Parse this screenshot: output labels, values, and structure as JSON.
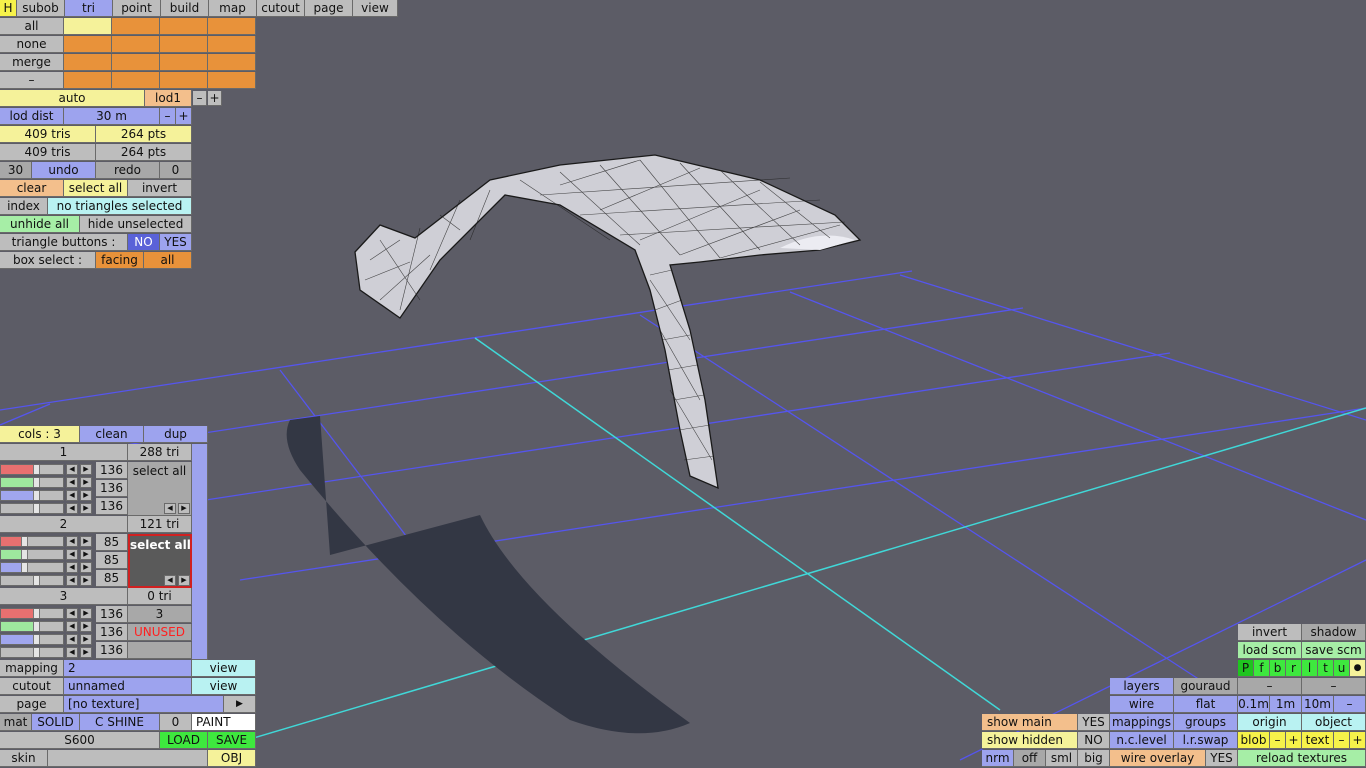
{
  "tabs": [
    "subob",
    "tri",
    "point",
    "build",
    "map",
    "cutout",
    "page",
    "view"
  ],
  "h_label": "H",
  "side_buttons": [
    "all",
    "none",
    "merge",
    "–"
  ],
  "lod": {
    "auto": "auto",
    "name": "lod1",
    "minus": "–",
    "plus": "+",
    "dist_label": "lod dist",
    "dist_value": "30 m"
  },
  "counts": {
    "tris1": "409 tris",
    "pts1": "264 pts",
    "tris2": "409 tris",
    "pts2": "264 pts"
  },
  "undo": {
    "count": "30",
    "undo": "undo",
    "redo": "redo",
    "redo_count": "0"
  },
  "select": {
    "clear": "clear",
    "select_all": "select all",
    "invert": "invert",
    "index": "index",
    "status": "no triangles selected",
    "unhide_all": "unhide all",
    "hide_unselected": "hide unselected",
    "tri_buttons_label": "triangle buttons :",
    "no": "NO",
    "yes": "YES",
    "box_select_label": "box select :",
    "facing": "facing",
    "all": "all"
  },
  "cols": {
    "label": "cols : 3",
    "clean": "clean",
    "dup": "dup"
  },
  "layers": [
    {
      "num": "1",
      "tris": "288 tri",
      "values": [
        "136",
        "136",
        "136"
      ],
      "action": "select all",
      "unused": ""
    },
    {
      "num": "2",
      "tris": "121 tri",
      "values": [
        "85",
        "85",
        "85"
      ],
      "action": "select all",
      "unused": ""
    },
    {
      "num": "3",
      "tris": "0 tri",
      "values": [
        "136",
        "136",
        "136"
      ],
      "action": "3",
      "unused": "UNUSED"
    }
  ],
  "bottom_left": {
    "mapping_label": "mapping",
    "mapping_value": "2",
    "view1": "view",
    "cutout_label": "cutout",
    "cutout_value": "unnamed",
    "view2": "view",
    "page_label": "page",
    "page_value": "[no texture]",
    "play": "▶",
    "mat": "mat",
    "solid": "SOLID",
    "cshine": "C SHINE",
    "zero": "0",
    "paint": "PAINT",
    "model": "S600",
    "load": "LOAD",
    "save": "SAVE",
    "skin": "skin",
    "obj": "OBJ"
  },
  "bottom_mid": {
    "show_main": "show main",
    "yes1": "YES",
    "show_hidden": "show hidden",
    "no1": "NO",
    "nrm": "nrm",
    "off": "off",
    "sml": "sml",
    "big": "big"
  },
  "bottom_right": {
    "layers": "layers",
    "gouraud": "gouraud",
    "wire": "wire",
    "flat": "flat",
    "mappings": "mappings",
    "groups": "groups",
    "nclevel": "n.c.level",
    "lrswap": "l.r.swap",
    "wire_overlay": "wire overlay",
    "yes": "YES",
    "invert": "invert",
    "shadow": "shadow",
    "load_scm": "load scm",
    "save_scm": "save scm",
    "views": [
      "P",
      "f",
      "b",
      "r",
      "l",
      "t",
      "u"
    ],
    "dot": "●",
    "dash1": "–",
    "dash2": "–",
    "d01": "0.1m",
    "d1": "1m",
    "d10": "10m",
    "dminus": "–",
    "origin": "origin",
    "object": "object",
    "blob": "blob",
    "minus": "–",
    "plus": "+",
    "text": "text",
    "reload": "reload textures",
    "tminus": "–",
    "tplus": "+"
  },
  "colors": {
    "background": "#5c5c66",
    "grid": "#5555ee",
    "grid_axis": "#40d8d8",
    "mesh": "#cfcfd6",
    "shadow": "#333744"
  }
}
